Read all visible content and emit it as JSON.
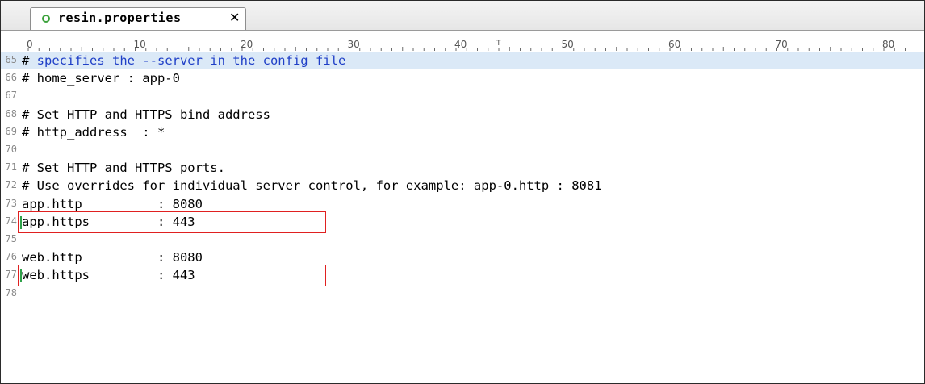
{
  "tab": {
    "label": "resin.properties",
    "close_glyph": "✕",
    "icon": "file-circle-icon"
  },
  "ruler": {
    "labels": [
      "0",
      "10",
      "20",
      "30",
      "40",
      "50",
      "60",
      "70",
      "80"
    ]
  },
  "editor": {
    "lines": [
      {
        "num": "65",
        "text": "# specifies the --server in the config file",
        "highlight": true
      },
      {
        "num": "66",
        "text": "# home_server : app-0"
      },
      {
        "num": "67",
        "text": ""
      },
      {
        "num": "68",
        "text": "# Set HTTP and HTTPS bind address"
      },
      {
        "num": "69",
        "text": "# http_address  : *"
      },
      {
        "num": "70",
        "text": ""
      },
      {
        "num": "71",
        "text": "# Set HTTP and HTTPS ports."
      },
      {
        "num": "72",
        "text": "# Use overrides for individual server control, for example: app-0.http : 8081"
      },
      {
        "num": "73",
        "text": "app.http          : 8080"
      },
      {
        "num": "74",
        "text": "app.https         : 443",
        "boxed": true
      },
      {
        "num": "75",
        "text": ""
      },
      {
        "num": "76",
        "text": "web.http          : 8080"
      },
      {
        "num": "77",
        "text": "web.https         : 443",
        "boxed": true
      },
      {
        "num": "78",
        "text": ""
      }
    ]
  },
  "colors": {
    "highlight_bg": "#dbe9f7",
    "comment_blue": "#1f3fc7",
    "box_red": "#e02020",
    "tab_icon_green": "#3aa13a"
  }
}
